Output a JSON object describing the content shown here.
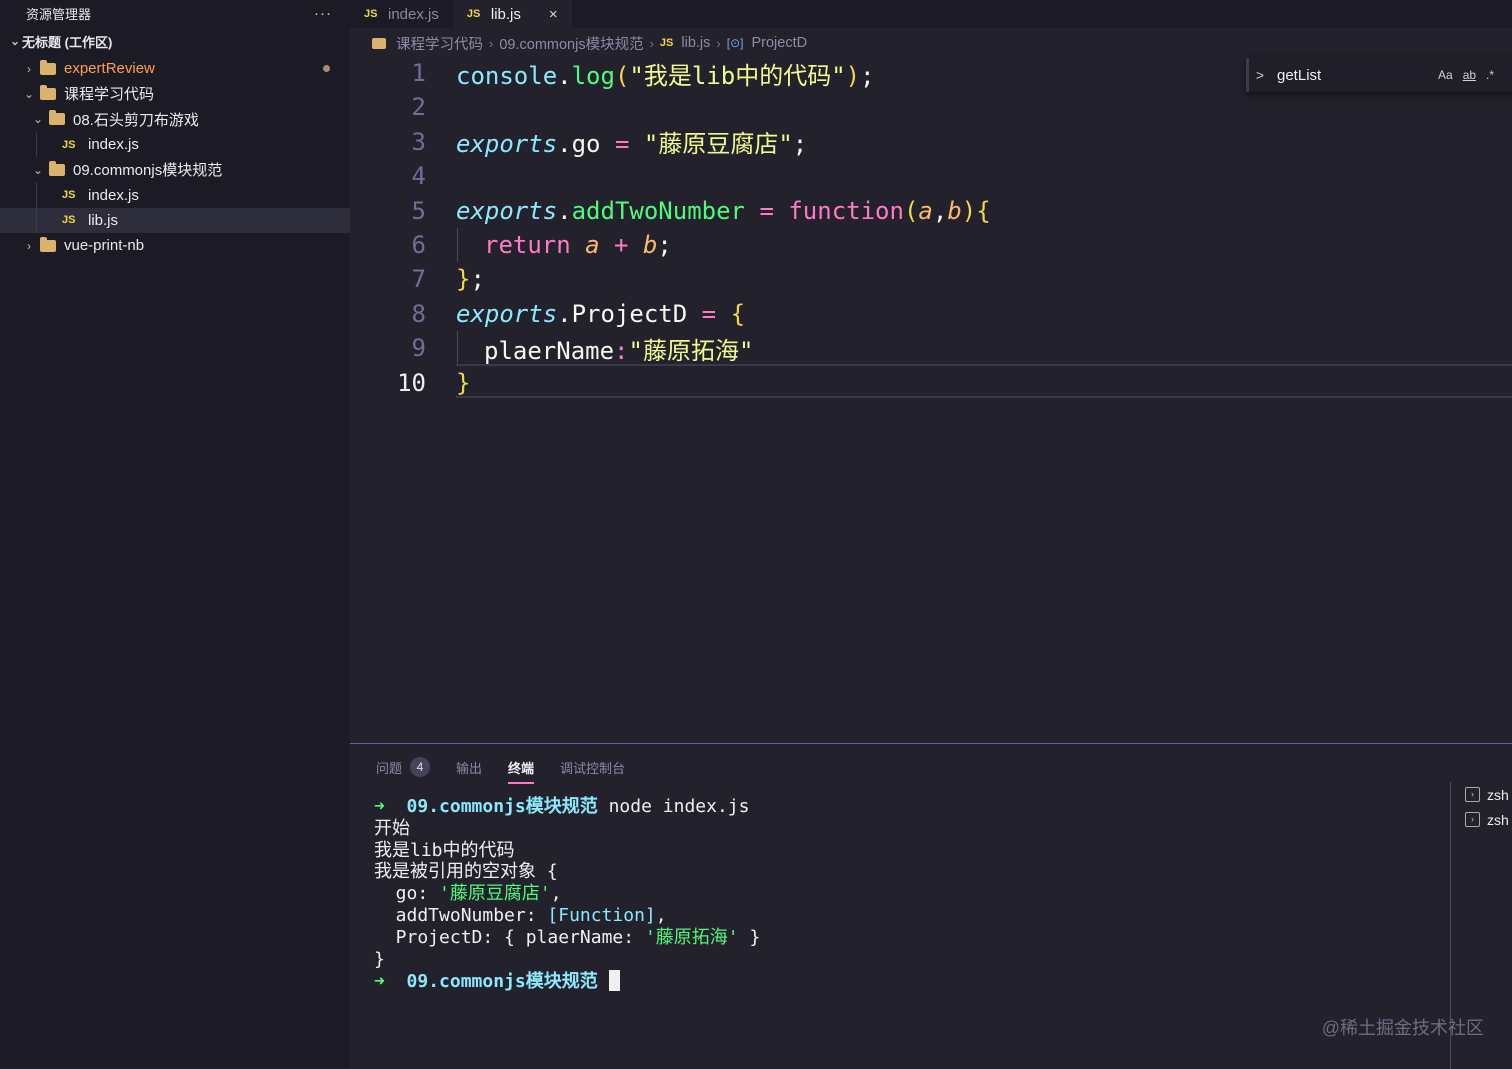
{
  "sidebar": {
    "title": "资源管理器",
    "more": "···",
    "workspace": "无标题 (工作区)",
    "items": [
      {
        "label": "expertReview",
        "type": "folder",
        "expanded": false,
        "color": "#ff9f4a"
      },
      {
        "label": "课程学习代码",
        "type": "folder",
        "expanded": true
      },
      {
        "label": "08.石头剪刀布游戏",
        "type": "folder",
        "expanded": true
      },
      {
        "label": "index.js",
        "type": "file",
        "icon": "JS"
      },
      {
        "label": "09.commonjs模块规范",
        "type": "folder",
        "expanded": true
      },
      {
        "label": "index.js",
        "type": "file",
        "icon": "JS"
      },
      {
        "label": "lib.js",
        "type": "file",
        "icon": "JS",
        "selected": true
      },
      {
        "label": "vue-print-nb",
        "type": "folder",
        "expanded": false
      }
    ]
  },
  "tabs": [
    {
      "icon": "JS",
      "label": "index.js",
      "active": false
    },
    {
      "icon": "JS",
      "label": "lib.js",
      "active": true,
      "close": "×"
    }
  ],
  "breadcrumb": {
    "items": [
      "课程学习代码",
      "09.commonjs模块规范",
      "lib.js",
      "ProjectD"
    ],
    "js_icon": "JS",
    "symbol_icon": "[⊙]"
  },
  "editor": {
    "line_numbers": [
      "1",
      "2",
      "3",
      "4",
      "5",
      "6",
      "7",
      "8",
      "9",
      "10"
    ],
    "active_line": "10",
    "tokens": {
      "l1": [
        "console",
        ".",
        "log",
        "(",
        "\"我是lib中的代码\"",
        ")",
        ";"
      ],
      "l3": [
        "exports",
        ".",
        "go",
        " = ",
        "\"藤原豆腐店\"",
        ";"
      ],
      "l5": [
        "exports",
        ".",
        "addTwoNumber",
        " = ",
        "function",
        "(",
        "a",
        ",",
        "b",
        ")",
        "{"
      ],
      "l6": [
        "return",
        " ",
        "a",
        " + ",
        "b",
        ";"
      ],
      "l7": [
        "}",
        ";"
      ],
      "l8": [
        "exports",
        ".",
        "ProjectD",
        " = ",
        "{"
      ],
      "l9": [
        "plaerName",
        ":",
        "\"藤原拓海\""
      ],
      "l10": [
        "}"
      ]
    }
  },
  "find": {
    "value": "getList",
    "chevron": ">",
    "match_case": "Aa",
    "whole_word": "ab",
    "regex": ".*"
  },
  "panel": {
    "tabs": [
      {
        "label": "问题",
        "badge": "4"
      },
      {
        "label": "输出"
      },
      {
        "label": "终端",
        "active": true
      },
      {
        "label": "调试控制台"
      }
    ],
    "terminal": {
      "prompt_arrow": "➜",
      "dir": "09.commonjs模块规范",
      "command": "node index.js",
      "out1": "开始",
      "out2": "我是lib中的代码",
      "out3": "我是被引用的空对象 {",
      "go_key": "  go: ",
      "go_val": "'藤原豆腐店'",
      "go_end": ",",
      "add_key": "  addTwoNumber: ",
      "add_val": "[Function]",
      "add_end": ",",
      "proj_key": "  ProjectD: { plaerName: ",
      "proj_val": "'藤原拓海'",
      "proj_end": " }",
      "close": "}"
    },
    "terminals": [
      "zsh",
      "zsh"
    ]
  },
  "watermark": "@稀土掘金技术社区"
}
